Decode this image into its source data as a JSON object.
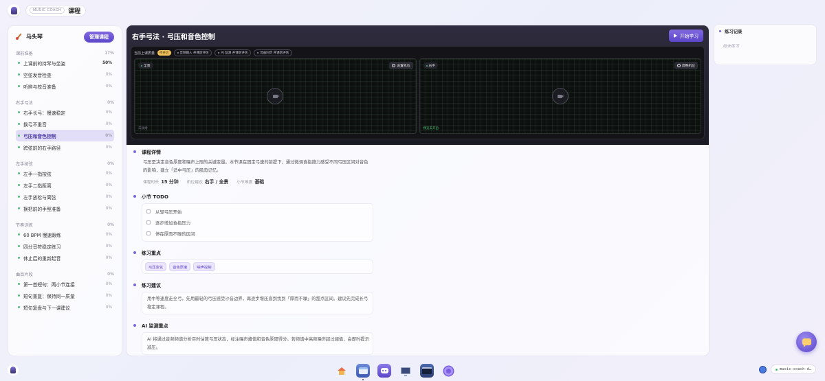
{
  "topbar": {
    "brand_tag": "MUSIC COACH",
    "title": "课程"
  },
  "sidebar": {
    "user_name": "马头琴",
    "manage_label": "管理课程",
    "groups": [
      {
        "name": "课前准备",
        "pct": "17%",
        "items": [
          {
            "label": "上课前的持琴与坐姿",
            "pct": "50%"
          },
          {
            "label": "空弦发音检查",
            "pct": "0%"
          },
          {
            "label": "听辨与校音准备",
            "pct": "0%"
          }
        ]
      },
      {
        "name": "右手弓法",
        "pct": "0%",
        "items": [
          {
            "label": "右手长弓：慢速稳定",
            "pct": "0%"
          },
          {
            "label": "换弓不重音",
            "pct": "0%"
          },
          {
            "label": "弓压和音色控制",
            "pct": "0%"
          },
          {
            "label": "跨弦前的右手路径",
            "pct": "0%"
          }
        ]
      },
      {
        "name": "左手按弦",
        "pct": "0%",
        "items": [
          {
            "label": "左手一指按弦",
            "pct": "0%"
          },
          {
            "label": "左手二指距离",
            "pct": "0%"
          },
          {
            "label": "左手放松与离弦",
            "pct": "0%"
          },
          {
            "label": "换把前的手型准备",
            "pct": "0%"
          }
        ]
      },
      {
        "name": "节奏训练",
        "pct": "0%",
        "items": [
          {
            "label": "60 BPM 慢速跟练",
            "pct": "0%"
          },
          {
            "label": "四分音符稳定练习",
            "pct": "0%"
          },
          {
            "label": "休止后的重新起音",
            "pct": "0%"
          }
        ]
      },
      {
        "name": "曲目片段",
        "pct": "0%",
        "items": [
          {
            "label": "第一首短句：两小节连接",
            "pct": "0%"
          },
          {
            "label": "短句重复：保持同一质量",
            "pct": "0%"
          },
          {
            "label": "短句复盘与下一课建议",
            "pct": "0%"
          }
        ]
      }
    ]
  },
  "main": {
    "title": "右手弓法 · 弓压和音色控制",
    "start_label": "开始学习",
    "cam_bar": {
      "current": "当前上课质量",
      "badge": "待开启",
      "chips": [
        "音频输入 开课后评估",
        "AI 监测 开课后评估",
        "音画同步 开课后评估"
      ]
    },
    "cams": [
      {
        "tag": "全景",
        "set": "设置机位",
        "status": "未就绪"
      },
      {
        "tag": "右手",
        "set": "调整机位",
        "status": "预览未开启"
      }
    ],
    "detail": {
      "title": "课程详情",
      "body": "弓压是决定音色厚度和噪声上限的关键变量。本节课在固定弓速的前提下，通过微调食指施力感受不同弓压区间对音色的影响，建立「适中弓压」的肌肉记忆。",
      "meta": [
        {
          "k": "课程时长",
          "v": "15 分钟"
        },
        {
          "k": "机位建议",
          "v": "右手 / 全景"
        },
        {
          "k": "小节难度",
          "v": "基础"
        }
      ]
    },
    "todo": {
      "title": "小节 TODO",
      "items": [
        "从轻弓压开始",
        "逐步增加食指压力",
        "停在厚而不噪的区间"
      ]
    },
    "focus": {
      "title": "练习重点",
      "tags": [
        "弓压变化",
        "音色厚度",
        "噪声控制"
      ]
    },
    "advice": {
      "title": "练习建议",
      "body": "用中等速度走全弓，先用最轻的弓压感受沙音边界，再逐步增压直到找到「厚而不噪」的甜点区间。建议先完成长弓稳定课程。"
    },
    "ai": {
      "title": "AI 监测重点",
      "body": "AI 将通过音频频谱分析实时估算弓压状态，标注噪声峰值和音色厚度得分。若频谱中高频噪声超过阈值，会即时提示减压。"
    }
  },
  "record": {
    "title": "练习记录",
    "empty": "尚未练习"
  },
  "dock": {
    "url": "music-coach-d…"
  },
  "icons": [
    "brush-icon",
    "play-icon",
    "gear-icon",
    "camera-icon",
    "chat-icon",
    "home-icon",
    "window-icon",
    "bot-icon",
    "monitor-icon",
    "terminal-icon",
    "settings-icon",
    "globe-icon"
  ],
  "colors": {
    "accent": "#5b46c9",
    "ok": "#4fbf7a",
    "warn": "#f0c05a"
  }
}
